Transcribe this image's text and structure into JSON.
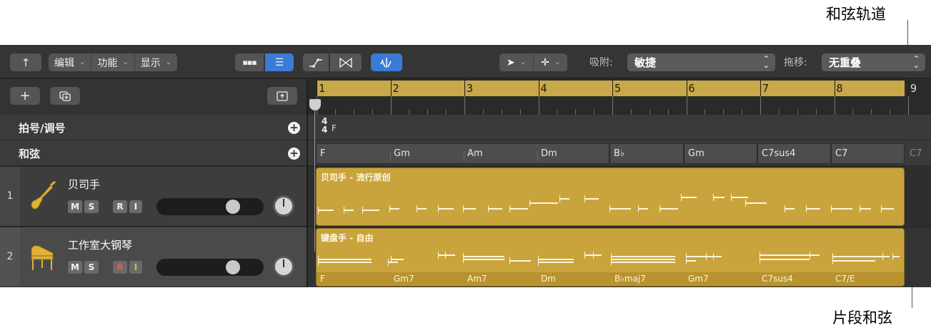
{
  "callouts": {
    "chord_track": "和弦轨道",
    "region_chords": "片段和弦"
  },
  "toolbar": {
    "back_icon": "back-arrow-icon",
    "edit": "编辑",
    "functions": "功能",
    "view": "显示",
    "snap_label": "吸附:",
    "snap_value": "敏捷",
    "drag_label": "拖移:",
    "drag_value": "无重叠"
  },
  "header": {
    "global_rows": {
      "signature": "拍号/调号",
      "chords": "和弦"
    }
  },
  "ruler": {
    "bars": [
      "1",
      "2",
      "3",
      "4",
      "5",
      "6",
      "7",
      "8",
      "9"
    ]
  },
  "signature": {
    "time_top": "4",
    "time_bottom": "4",
    "key": "F"
  },
  "chord_track": {
    "chords": [
      "F",
      "Gm",
      "Am",
      "Dm",
      "B♭",
      "Gm",
      "C7sus4",
      "C7",
      "C7"
    ]
  },
  "tracks": [
    {
      "number": "1",
      "name": "贝司手",
      "region_title": "贝司手 - 流行原创",
      "buttons": [
        "M",
        "S",
        "R",
        "I"
      ]
    },
    {
      "number": "2",
      "name": "工作室大钢琴",
      "region_title": "键盘手 - 自由",
      "buttons": [
        "M",
        "S",
        "R",
        "I"
      ],
      "region_chords": [
        "F",
        "Gm7",
        "Am7",
        "Dm",
        "B♭maj7",
        "Gm7",
        "C7sus4",
        "C7/E"
      ]
    }
  ],
  "colors": {
    "region": "#c9a43c",
    "active_blue": "#3a7bd5",
    "record_red": "#e05a5a",
    "input_yellow": "#e0b84a"
  }
}
